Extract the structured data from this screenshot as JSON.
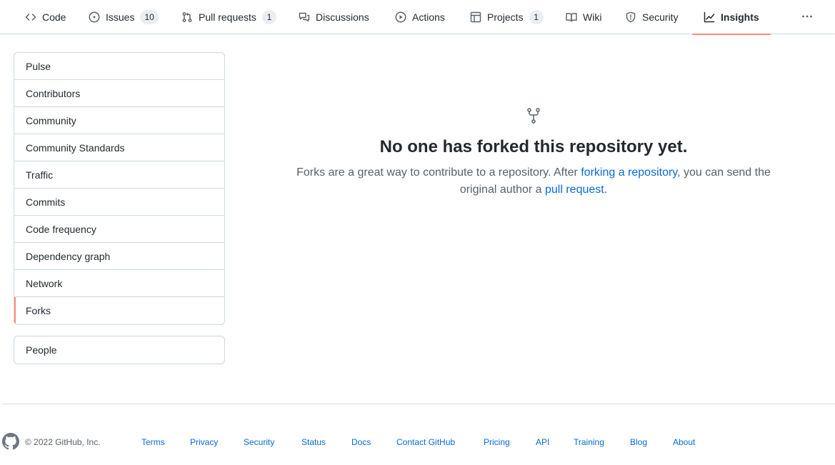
{
  "repo_nav": {
    "tabs": [
      {
        "label": "Code",
        "icon": "code-icon"
      },
      {
        "label": "Issues",
        "icon": "issue-opened-icon",
        "count": "10"
      },
      {
        "label": "Pull requests",
        "icon": "git-pull-request-icon",
        "count": "1"
      },
      {
        "label": "Discussions",
        "icon": "comment-discussion-icon"
      },
      {
        "label": "Actions",
        "icon": "play-icon"
      },
      {
        "label": "Projects",
        "icon": "table-icon",
        "count": "1"
      },
      {
        "label": "Wiki",
        "icon": "book-icon"
      },
      {
        "label": "Security",
        "icon": "shield-icon"
      },
      {
        "label": "Insights",
        "icon": "graph-icon",
        "selected": true
      }
    ],
    "more_icon": "kebab-horizontal-icon"
  },
  "sidebar": {
    "insights_items": [
      {
        "label": "Pulse"
      },
      {
        "label": "Contributors"
      },
      {
        "label": "Community"
      },
      {
        "label": "Community Standards"
      },
      {
        "label": "Traffic"
      },
      {
        "label": "Commits"
      },
      {
        "label": "Code frequency"
      },
      {
        "label": "Dependency graph"
      },
      {
        "label": "Network"
      },
      {
        "label": "Forks",
        "selected": true
      }
    ],
    "people_items": [
      {
        "label": "People"
      }
    ]
  },
  "blankslate": {
    "icon": "repo-forked-icon",
    "title": "No one has forked this repository yet.",
    "text_before": "Forks are a great way to contribute to a repository. After ",
    "link1": "forking a repository",
    "text_middle": ", you can send the original author a ",
    "link2": "pull request",
    "text_after": "."
  },
  "footer": {
    "logo_icon": "github-mark-icon",
    "copyright": "© 2022 GitHub, Inc.",
    "links": [
      "Terms",
      "Privacy",
      "Security",
      "Status",
      "Docs",
      "Contact GitHub",
      "Pricing",
      "API",
      "Training",
      "Blog",
      "About"
    ]
  },
  "colors": {
    "accent_underline": "#fd8c73",
    "link": "#0969da",
    "border": "#d0d7de"
  }
}
